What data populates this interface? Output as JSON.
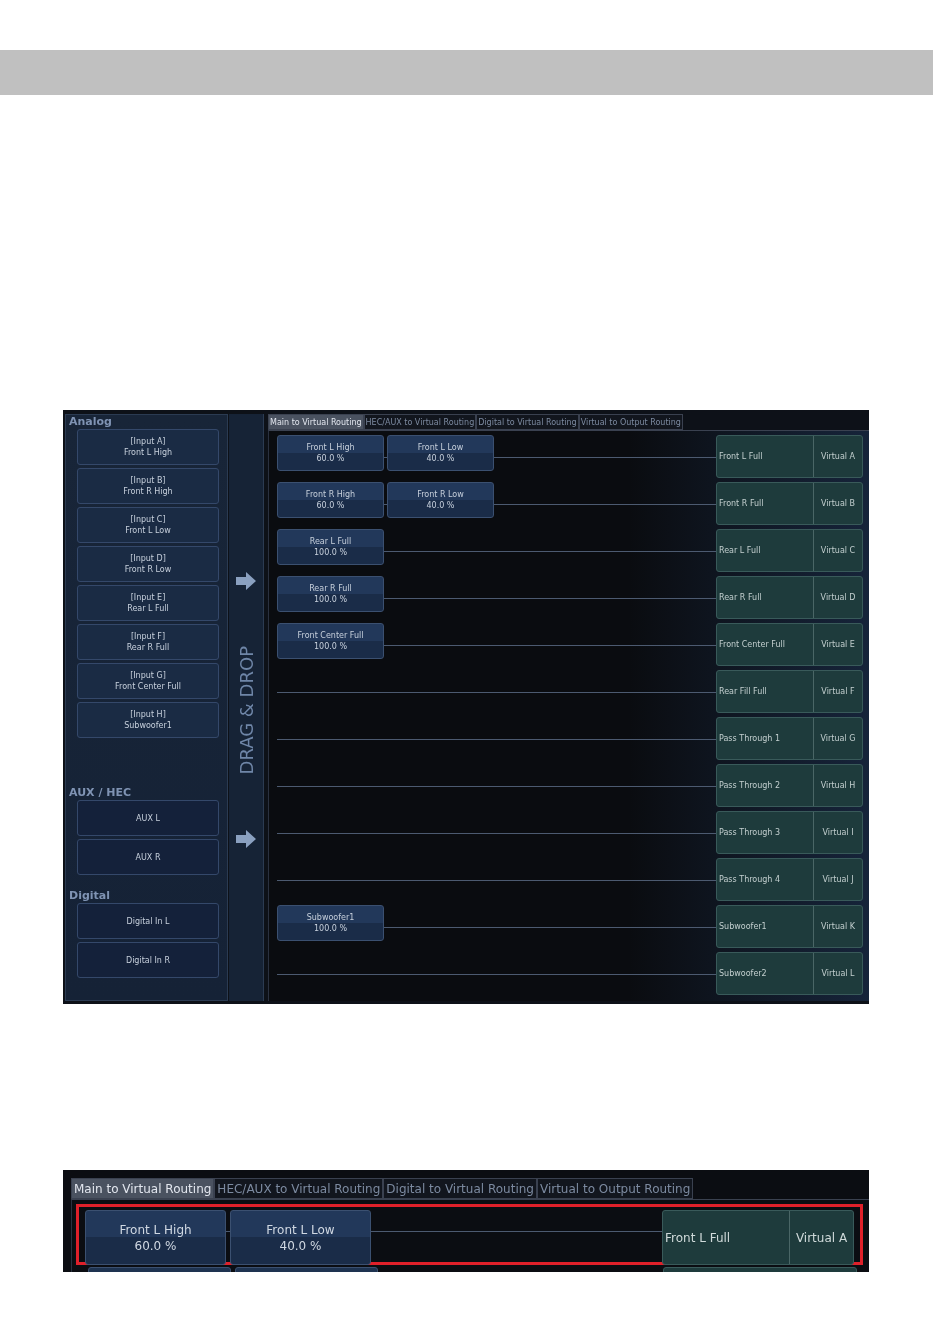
{
  "screen": {
    "sections": [
      {
        "title": "Analog",
        "inputs": [
          {
            "lines": [
              "[Input A]",
              "Front L High"
            ]
          },
          {
            "lines": [
              "[Input B]",
              "Front R High"
            ]
          },
          {
            "lines": [
              "[Input C]",
              "Front L Low"
            ]
          },
          {
            "lines": [
              "[Input D]",
              "Front R Low"
            ]
          },
          {
            "lines": [
              "[Input E]",
              "Rear L Full"
            ]
          },
          {
            "lines": [
              "[Input F]",
              "Rear R Full"
            ]
          },
          {
            "lines": [
              "[Input G]",
              "Front Center Full"
            ]
          },
          {
            "lines": [
              "[Input H]",
              "Subwoofer1"
            ]
          }
        ]
      },
      {
        "title": "AUX / HEC",
        "inputs": [
          {
            "lines": [
              "AUX L"
            ]
          },
          {
            "lines": [
              "AUX R"
            ]
          }
        ]
      },
      {
        "title": "Digital",
        "inputs": [
          {
            "lines": [
              "Digital In L"
            ]
          },
          {
            "lines": [
              "Digital In R"
            ]
          }
        ]
      }
    ],
    "drag_label": "DRAG & DROP",
    "tabs": [
      {
        "label": "Main to Virtual Routing",
        "selected": true
      },
      {
        "label": "HEC/AUX to Virtual Routing",
        "selected": false
      },
      {
        "label": "Digital to Virtual Routing",
        "selected": false
      },
      {
        "label": "Virtual to Output Routing",
        "selected": false
      }
    ],
    "rows": [
      {
        "sources": [
          {
            "name": "Front L High",
            "percent": "60.0 %"
          },
          {
            "name": "Front L Low",
            "percent": "40.0 %"
          }
        ],
        "target": "Front L Full",
        "virtual": "Virtual A"
      },
      {
        "sources": [
          {
            "name": "Front R High",
            "percent": "60.0 %"
          },
          {
            "name": "Front R Low",
            "percent": "40.0 %"
          }
        ],
        "target": "Front R Full",
        "virtual": "Virtual B"
      },
      {
        "sources": [
          {
            "name": "Rear L Full",
            "percent": "100.0 %"
          }
        ],
        "target": "Rear L Full",
        "virtual": "Virtual C"
      },
      {
        "sources": [
          {
            "name": "Rear R Full",
            "percent": "100.0 %"
          }
        ],
        "target": "Rear R Full",
        "virtual": "Virtual D"
      },
      {
        "sources": [
          {
            "name": "Front Center Full",
            "percent": "100.0 %"
          }
        ],
        "target": "Front Center Full",
        "virtual": "Virtual E"
      },
      {
        "sources": [],
        "target": "Rear Fill Full",
        "virtual": "Virtual F"
      },
      {
        "sources": [],
        "target": "Pass Through 1",
        "virtual": "Virtual G"
      },
      {
        "sources": [],
        "target": "Pass Through 2",
        "virtual": "Virtual H"
      },
      {
        "sources": [],
        "target": "Pass Through 3",
        "virtual": "Virtual I"
      },
      {
        "sources": [],
        "target": "Pass Through 4",
        "virtual": "Virtual J"
      },
      {
        "sources": [
          {
            "name": "Subwoofer1",
            "percent": "100.0 %"
          }
        ],
        "target": "Subwoofer1",
        "virtual": "Virtual K"
      },
      {
        "sources": [],
        "target": "Subwoofer2",
        "virtual": "Virtual L"
      }
    ]
  },
  "zoom": {
    "tabs": [
      {
        "label": "Main to Virtual Routing",
        "selected": true
      },
      {
        "label": "HEC/AUX to Virtual Routing",
        "selected": false
      },
      {
        "label": "Digital to Virtual Routing",
        "selected": false
      },
      {
        "label": "Virtual to Output Routing",
        "selected": false
      }
    ],
    "row": {
      "highlighted": true,
      "sources": [
        {
          "name": "Front L High",
          "percent": "60.0 %"
        },
        {
          "name": "Front L Low",
          "percent": "40.0 %"
        }
      ],
      "target": "Front L Full",
      "virtual": "Virtual A"
    }
  }
}
